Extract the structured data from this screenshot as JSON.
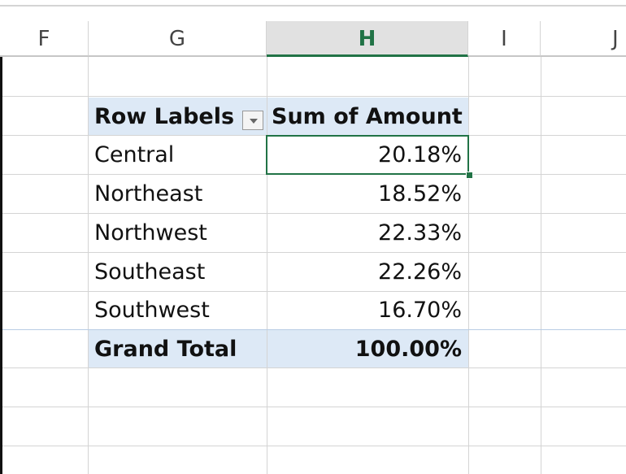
{
  "columns": [
    "F",
    "G",
    "H",
    "I",
    "J"
  ],
  "selected_column": "H",
  "pivot": {
    "header": {
      "row_labels": "Row Labels",
      "value_header": "Sum of Amount"
    },
    "rows": [
      {
        "label": "Central",
        "value": "20.18%"
      },
      {
        "label": "Northeast",
        "value": "18.52%"
      },
      {
        "label": "Northwest",
        "value": "22.33%"
      },
      {
        "label": "Southeast",
        "value": "22.26%"
      },
      {
        "label": "Southwest",
        "value": "16.70%"
      }
    ],
    "grand_total": {
      "label": "Grand Total",
      "value": "100.00%"
    }
  },
  "colors": {
    "accent": "#217346",
    "pivot_band": "#dde9f6"
  }
}
